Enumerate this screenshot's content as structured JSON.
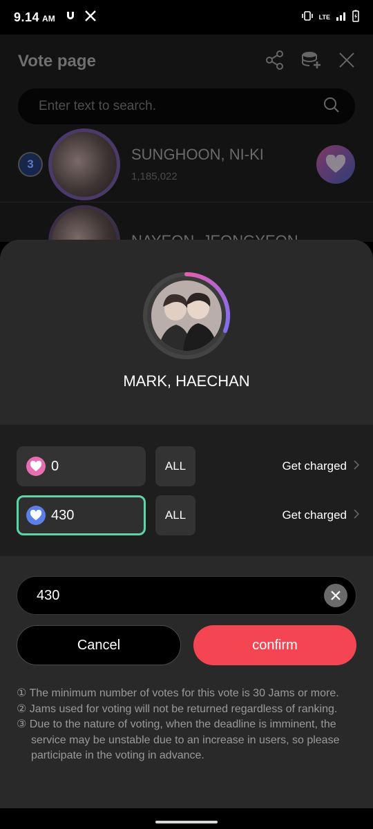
{
  "status_bar": {
    "time": "9.14",
    "ampm": "AM",
    "network": "LTE"
  },
  "background": {
    "title": "Vote page",
    "search": {
      "placeholder": "Enter text to search."
    },
    "rows": [
      {
        "rank": "3",
        "name": "SUNGHOON, NI-KI",
        "votes": "1,185,022"
      },
      {
        "rank": "",
        "name": "NAYEON, JEONGYEON",
        "votes": ""
      }
    ]
  },
  "sheet": {
    "candidate_name": "MARK, HAECHAN",
    "jam_rows": [
      {
        "icon": "heart-pink-icon",
        "value": "0",
        "all_label": "ALL",
        "charge_label": "Get charged",
        "active": false
      },
      {
        "icon": "heart-blue-icon",
        "value": "430",
        "all_label": "ALL",
        "charge_label": "Get charged",
        "active": true
      }
    ],
    "amount_value": "430",
    "cancel_label": "Cancel",
    "confirm_label": "confirm",
    "notes": [
      "① The minimum number of votes for this vote is 30 Jams or more.",
      "② Jams used for voting will not be returned regardless of ranking.",
      "③ Due to the nature of voting, when the deadline is imminent, the service may be unstable due to an increase in users, so please participate in the voting in advance."
    ]
  },
  "colors": {
    "accent_confirm": "#f44553",
    "active_border": "#5fd6a8",
    "jam_pink": "#e76eb2",
    "jam_blue": "#5b7fe6"
  }
}
